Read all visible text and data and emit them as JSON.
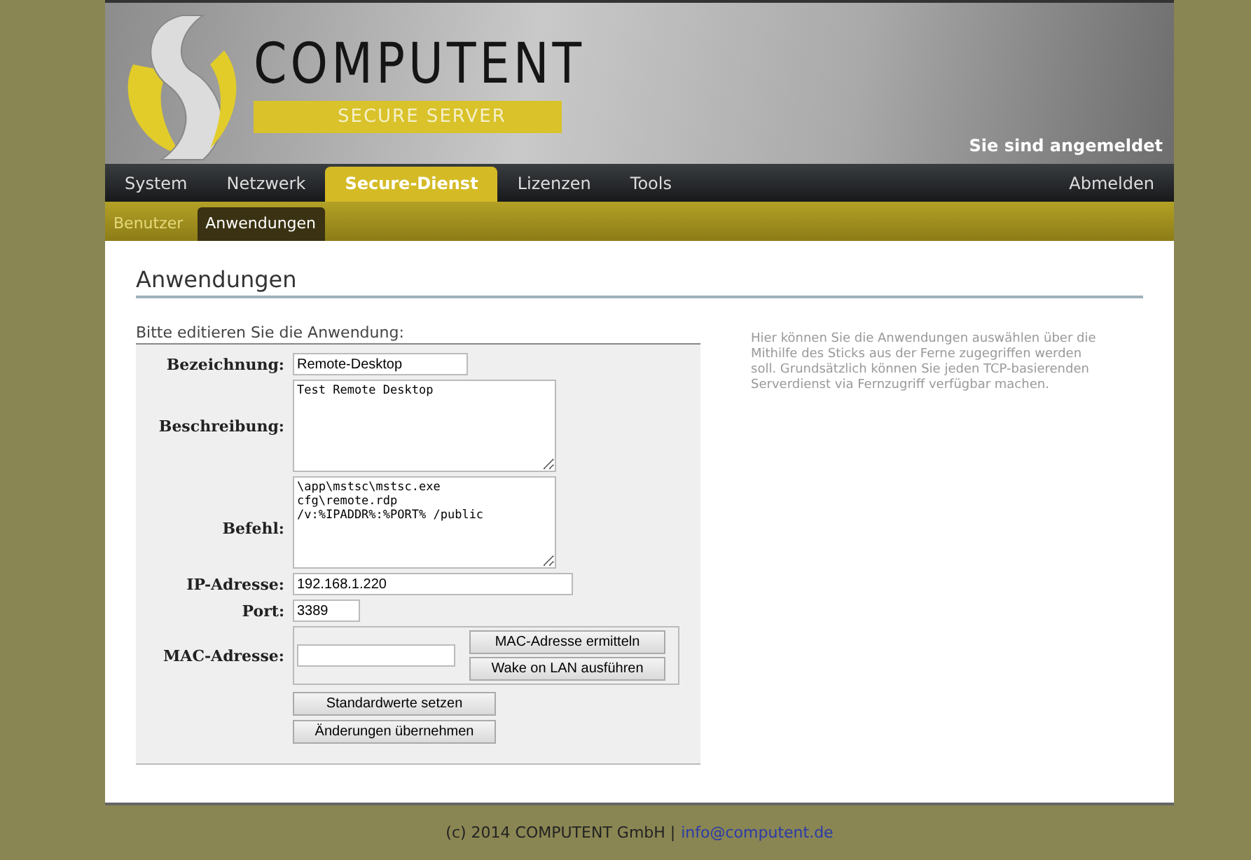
{
  "header": {
    "brand": "COMPUTENT",
    "subtitle": "SECURE SERVER",
    "status": "Sie sind angemeldet"
  },
  "nav": {
    "items": [
      {
        "label": "System",
        "selected": false
      },
      {
        "label": "Netzwerk",
        "selected": false
      },
      {
        "label": "Secure-Dienst",
        "selected": true
      },
      {
        "label": "Lizenzen",
        "selected": false
      },
      {
        "label": "Tools",
        "selected": false
      }
    ],
    "logout": "Abmelden"
  },
  "subnav": [
    {
      "label": "Benutzer",
      "selected": false
    },
    {
      "label": "Anwendungen",
      "selected": true
    }
  ],
  "page_title": "Anwendungen",
  "form": {
    "legend": "Bitte editieren Sie die Anwendung:",
    "name": {
      "label": "Bezeichnung:",
      "value": "Remote-Desktop"
    },
    "description": {
      "label": "Beschreibung:",
      "value": "Test Remote Desktop"
    },
    "command": {
      "label": "Befehl:",
      "value": "\\app\\mstsc\\mstsc.exe\ncfg\\remote.rdp\n/v:%IPADDR%:%PORT% /public"
    },
    "ip": {
      "label": "IP-Adresse:",
      "value": "192.168.1.220"
    },
    "port": {
      "label": "Port:",
      "value": "3389"
    },
    "mac": {
      "label": "MAC-Adresse:",
      "buttons": [
        "MAC-Adresse ermitteln",
        "Wake on LAN ausführen"
      ]
    },
    "buttons": [
      "Standardwerte setzen",
      "Änderungen übernehmen"
    ]
  },
  "help": "Hier können Sie die Anwendungen auswählen über die Mithilfe des Sticks aus der Ferne zugegriffen werden soll. Grundsätzlich können Sie jeden TCP-basierenden Serverdienst via Fernzugriff verfügbar machen.",
  "footer": {
    "copyright": "(c) 2014 COMPUTENT GmbH |",
    "email": "info@computent.de"
  }
}
